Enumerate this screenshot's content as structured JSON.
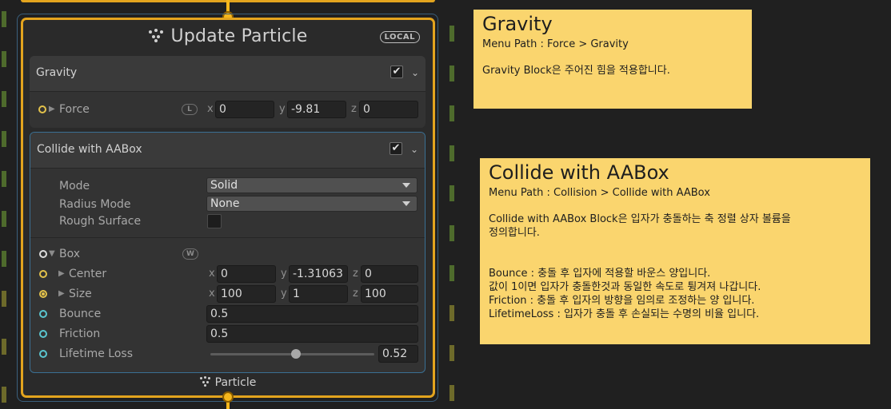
{
  "node": {
    "title": "Update Particle",
    "space_badge": "LOCAL",
    "output_label": "Particle"
  },
  "gravity_block": {
    "title": "Gravity",
    "enabled": true,
    "force": {
      "label": "Force",
      "space": "L",
      "x_label": "x",
      "x": "0",
      "y_label": "y",
      "y": "-9.81",
      "z_label": "z",
      "z": "0"
    }
  },
  "collide_block": {
    "title": "Collide with AABox",
    "enabled": true,
    "mode": {
      "label": "Mode",
      "value": "Solid"
    },
    "radius_mode": {
      "label": "Radius Mode",
      "value": "None"
    },
    "rough_surface": {
      "label": "Rough Surface",
      "checked": false
    },
    "box": {
      "label": "Box",
      "space": "W"
    },
    "center": {
      "label": "Center",
      "x_label": "x",
      "x": "0",
      "y_label": "y",
      "y": "-1.31063",
      "z_label": "z",
      "z": "0"
    },
    "size": {
      "label": "Size",
      "x_label": "x",
      "x": "100",
      "y_label": "y",
      "y": "1",
      "z_label": "z",
      "z": "100"
    },
    "bounce": {
      "label": "Bounce",
      "value": "0.5"
    },
    "friction": {
      "label": "Friction",
      "value": "0.5"
    },
    "lifetime_loss": {
      "label": "Lifetime Loss",
      "value": "0.52",
      "fraction": 0.52
    }
  },
  "notes": {
    "gravity": {
      "title": "Gravity",
      "subtitle": "Menu Path : Force > Gravity",
      "body": "Gravity Block은 주어진 힘을 적용합니다."
    },
    "collide": {
      "title": "Collide with AABox",
      "subtitle": "Menu Path : Collision > Collide with AABox",
      "body": "Collide with AABox Block은 입자가 충돌하는 축 정렬 상자 볼륨을\n정의합니다.\n\n\nBounce : 충돌 후 입자에 적용할 바운스 양입니다.\n값이 1이면 입자가 충돌한것과 동일한 속도로 튕겨져 나갑니다.\nFriction : 충돌 후 입자의 방향을 임의로 조정하는 양 입니다.\nLifetimeLoss : 입자가 충돌 후 손실되는 수명의 비율 입니다."
    }
  },
  "colors": {
    "node_border": "#e3a41e",
    "note_bg": "#fad56e",
    "port_yellow": "#e3c24b",
    "port_cyan": "#5ac6d0"
  }
}
